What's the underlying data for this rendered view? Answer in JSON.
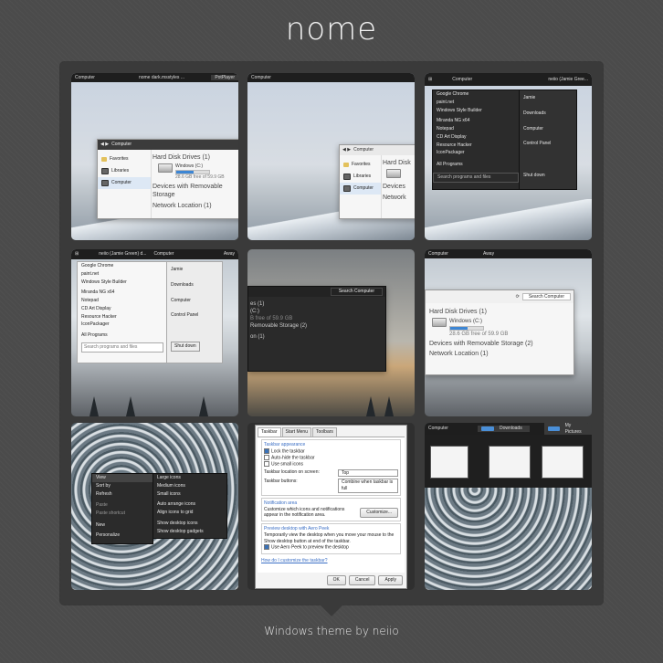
{
  "title": "nome",
  "credit": "Windows theme by neiio",
  "shot1": {
    "tabs": [
      "Computer",
      "nome dark.msstyles ...",
      "PotPlayer"
    ],
    "nav": "Computer",
    "side": [
      "Favorites",
      "Libraries",
      "Computer"
    ],
    "hdd_header": "Hard Disk Drives (1)",
    "drive": "Windows (C:)",
    "free": "28.6 GB free of 59.9 GB",
    "removable": "Devices with Removable Storage",
    "network": "Network Location (1)"
  },
  "shot2": {
    "tab": "Computer",
    "nav": "Computer",
    "side": [
      "Favorites",
      "Libraries",
      "Computer"
    ],
    "hdd_header": "Hard Disk",
    "removable": "Devices",
    "network": "Network"
  },
  "shot3": {
    "taskbar": [
      "Computer",
      "neiio (Jamie Gree..."
    ],
    "programs": [
      "Google Chrome",
      "paint.net",
      "Windows Style Builder",
      "Miranda NG x64",
      "Notepad",
      "CD Art Display",
      "Resource Hacker",
      "IconPackager"
    ],
    "all_programs": "All Programs",
    "search": "Search programs and files",
    "right": [
      "Jamie",
      "Downloads",
      "Computer",
      "Control Panel"
    ],
    "shutdown": "Shut down"
  },
  "shot4": {
    "taskbar": [
      "neiio (Jamie Green) d...",
      "Computer",
      "Away"
    ],
    "programs": [
      "Google Chrome",
      "paint.net",
      "Windows Style Builder",
      "Miranda NG x64",
      "Notepad",
      "CD Art Display",
      "Resource Hacker",
      "IconPackager"
    ],
    "all_programs": "All Programs",
    "search": "Search programs and files",
    "right": [
      "Jamie",
      "Downloads",
      "Computer",
      "Control Panel"
    ],
    "shutdown": "Shut down"
  },
  "shot5": {
    "search": "Search Computer",
    "lines": [
      "es (1)",
      "(C:)",
      "B free of 59.9 GB",
      "Removable Storage (2)",
      "on (1)"
    ]
  },
  "shot6": {
    "taskbar": [
      "Computer",
      "Away"
    ],
    "search": "Search Computer",
    "hdd_header": "Hard Disk Drives (1)",
    "drive": "Windows (C:)",
    "free": "28.6 GB free of 59.9 GB",
    "removable": "Devices with Removable Storage (2)",
    "network": "Network Location (1)"
  },
  "shot7": {
    "menu": [
      "View",
      "Sort by",
      "Refresh",
      "Paste",
      "Paste shortcut",
      "New",
      "Personalize"
    ],
    "submenu": [
      "Large icons",
      "Medium icons",
      "Small icons",
      "Auto arrange icons",
      "Align icons to grid",
      "Show desktop icons",
      "Show desktop gadgets"
    ]
  },
  "shot8": {
    "tabs": [
      "Taskbar",
      "Start Menu",
      "Toolbars"
    ],
    "group1": "Taskbar appearance",
    "checks": [
      "Lock the taskbar",
      "Auto-hide the taskbar",
      "Use small icons"
    ],
    "location_label": "Taskbar location on screen:",
    "location_value": "Top",
    "buttons_label": "Taskbar buttons:",
    "buttons_value": "Combine when taskbar is full",
    "group2": "Notification area",
    "notif_text": "Customize which icons and notifications appear in the notification area.",
    "customize": "Customize...",
    "group3": "Preview desktop with Aero Peek",
    "peek_text": "Temporarily view the desktop when you move your mouse to the Show desktop button at end of the taskbar.",
    "peek_check": "Use Aero Peek to preview the desktop",
    "help_link": "How do I customize the taskbar?",
    "ok": "OK",
    "cancel": "Cancel",
    "apply": "Apply"
  },
  "shot9": {
    "taskbar": [
      "Computer",
      "Downloads",
      "My Pictures"
    ]
  }
}
